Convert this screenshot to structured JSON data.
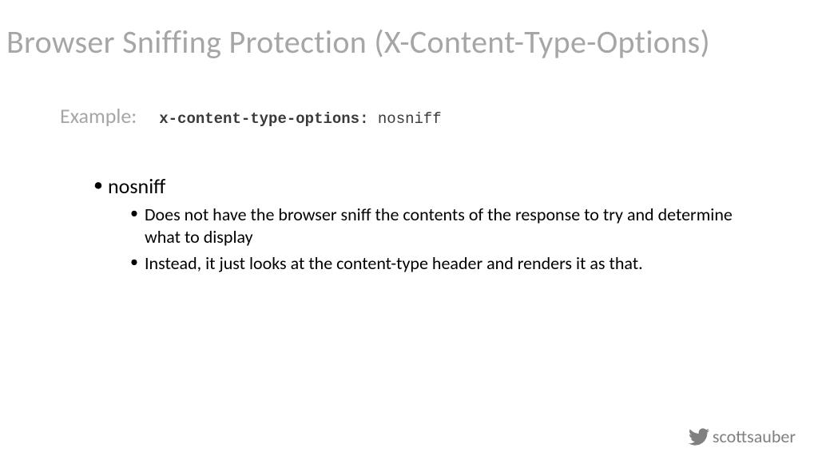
{
  "title": "Browser Sniffing Protection (X-Content-Type-Options)",
  "example": {
    "label": "Example:",
    "header_name": "x-content-type-options:",
    "header_value": "nosniff"
  },
  "bullets": {
    "l1": "nosniff",
    "l2a": "Does not have the browser sniff the contents of the response to try and determine what to display",
    "l2b": "Instead, it just looks at the content-type header and renders it as that."
  },
  "footer": {
    "handle": "scottsauber"
  }
}
